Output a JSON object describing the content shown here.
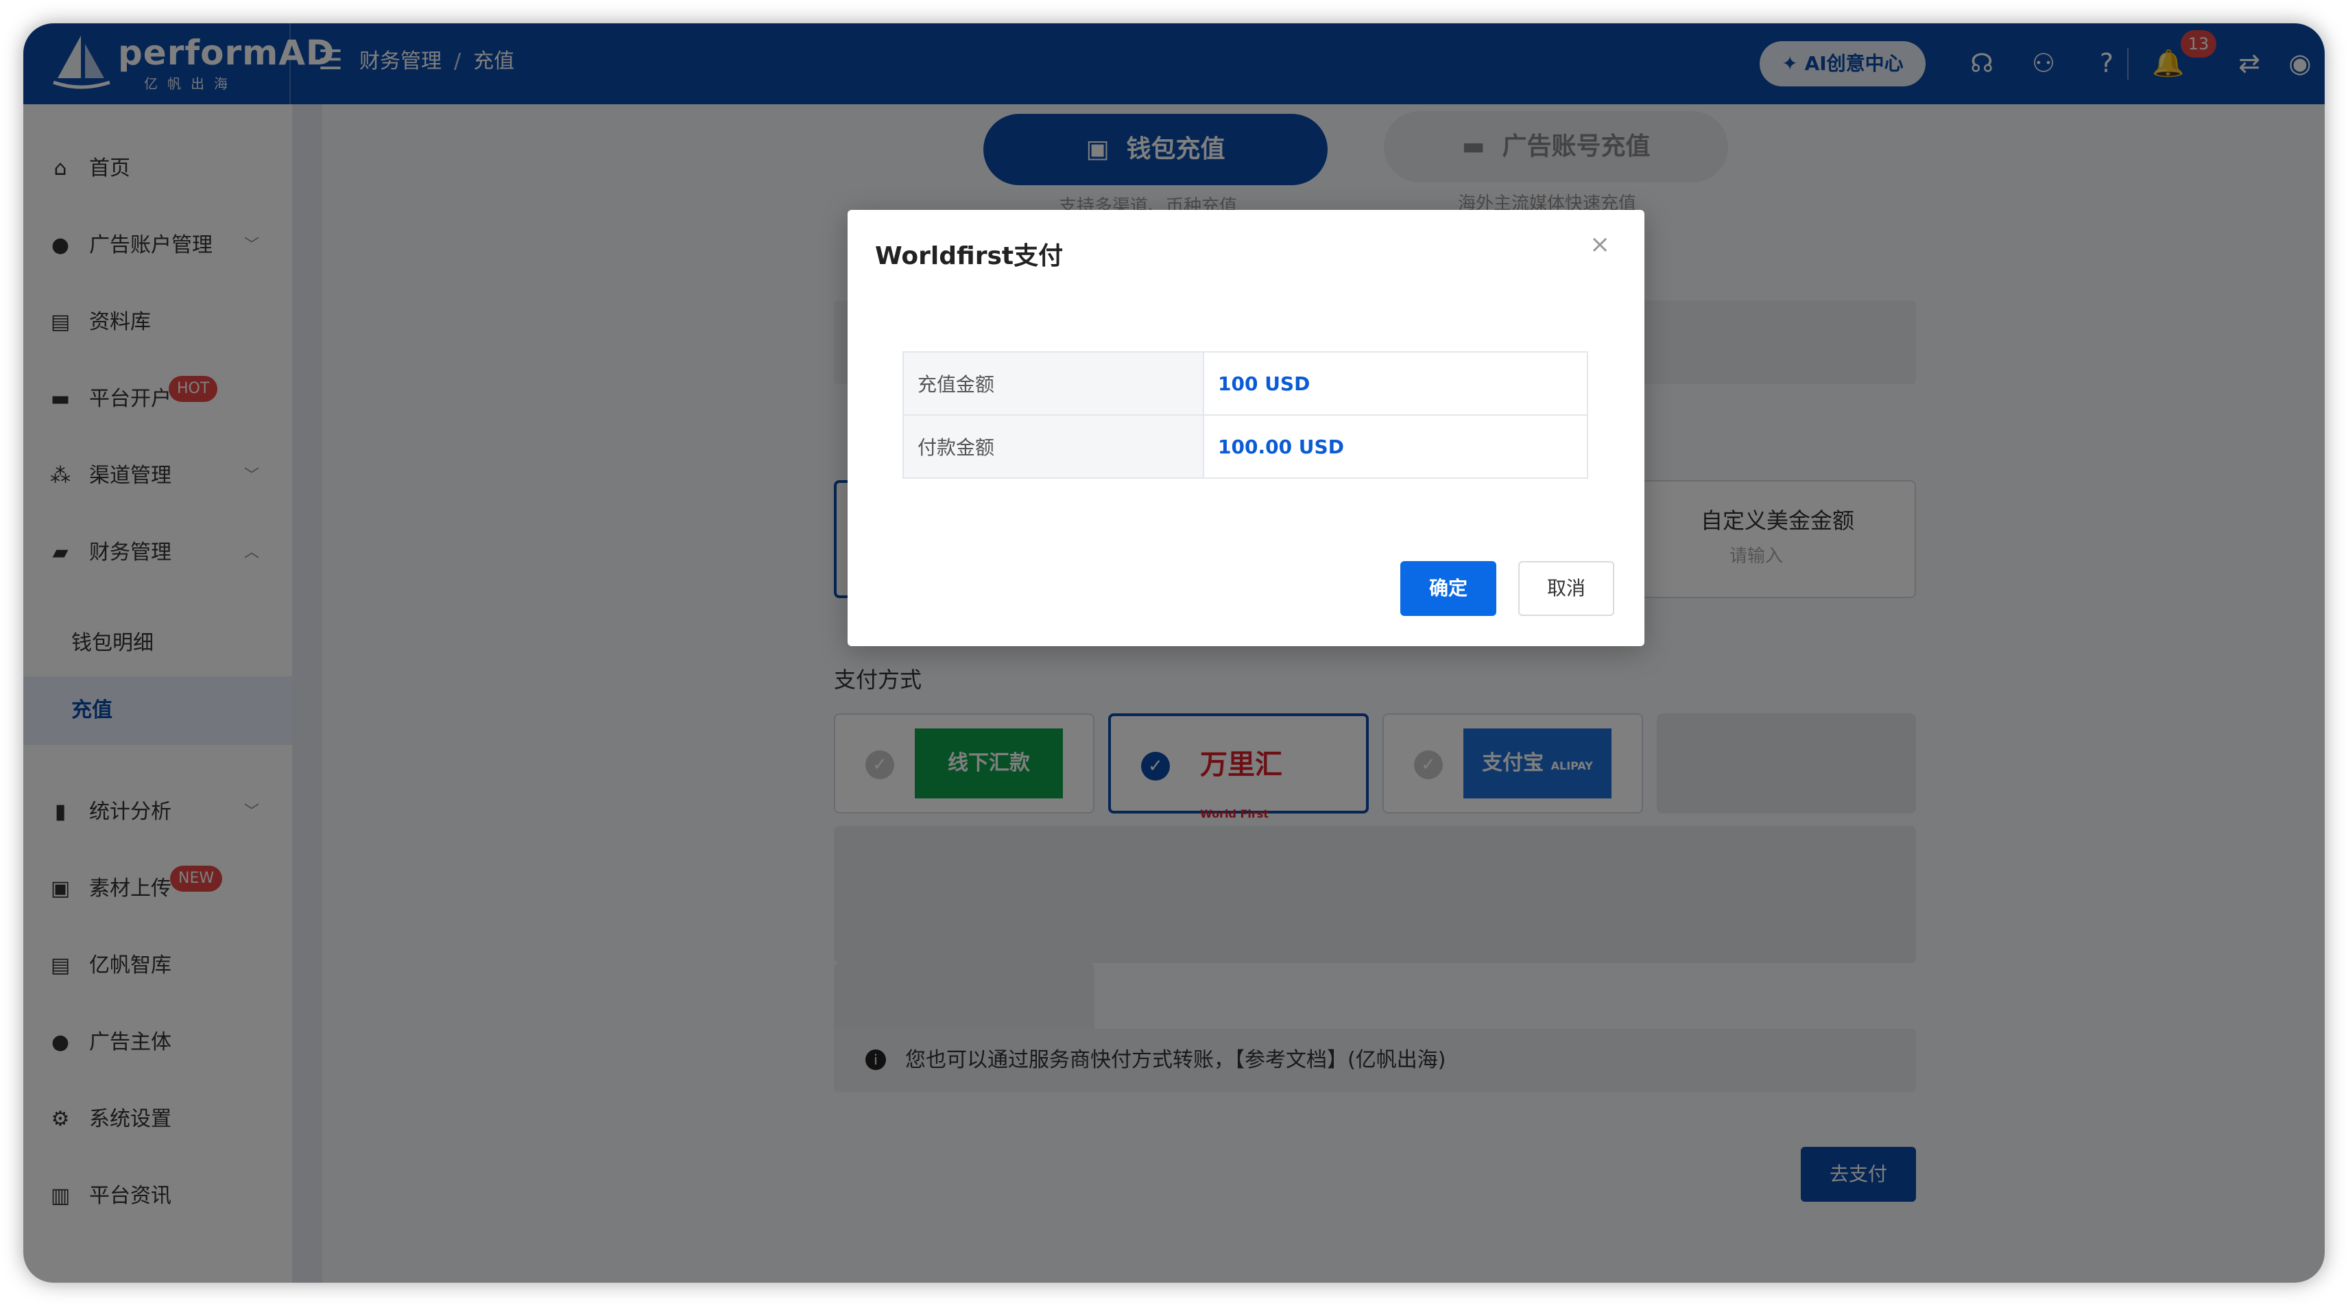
{
  "brand": {
    "name": "performAD",
    "sub": "亿帆出海"
  },
  "breadcrumb": {
    "parent": "财务管理",
    "current": "充值"
  },
  "header": {
    "ai_button": "AI创意中心",
    "notification_count": "13"
  },
  "sidebar": {
    "items": [
      {
        "label": "首页"
      },
      {
        "label": "广告账户管理"
      },
      {
        "label": "资料库"
      },
      {
        "label": "平台开户",
        "tag": "HOT"
      },
      {
        "label": "渠道管理"
      },
      {
        "label": "财务管理"
      },
      {
        "label": "钱包明细"
      },
      {
        "label": "充值"
      },
      {
        "label": "统计分析"
      },
      {
        "label": "素材上传",
        "tag": "NEW"
      },
      {
        "label": "亿帆智库"
      },
      {
        "label": "广告主体"
      },
      {
        "label": "系统设置"
      },
      {
        "label": "平台资讯"
      }
    ]
  },
  "recharge": {
    "wallet_tab": "钱包充值",
    "wallet_caption": "支持多渠道、币种充值",
    "ad_tab": "广告账号充值",
    "ad_caption": "海外主流媒体快速充值",
    "custom_amount_title": "自定义美金金额",
    "custom_amount_placeholder": "请输入",
    "payment_section": "支付方式",
    "payment_methods": [
      {
        "label": "线下汇款"
      },
      {
        "label": "万里汇",
        "sub": "World First"
      },
      {
        "label": "支付宝",
        "sub": "ALIPAY"
      }
    ],
    "notice": "您也可以通过服务商快付方式转账，【参考文档】(亿帆出海)",
    "go_pay": "去支付"
  },
  "modal": {
    "title": "Worldfirst支付",
    "rows": [
      {
        "key": "充值金额",
        "value": "100 USD"
      },
      {
        "key": "付款金额",
        "value": "100.00 USD"
      }
    ],
    "confirm": "确定",
    "cancel": "取消"
  },
  "colors": {
    "primary": "#0a4aa8",
    "accent": "#0a6ae6",
    "danger": "#e84646"
  }
}
